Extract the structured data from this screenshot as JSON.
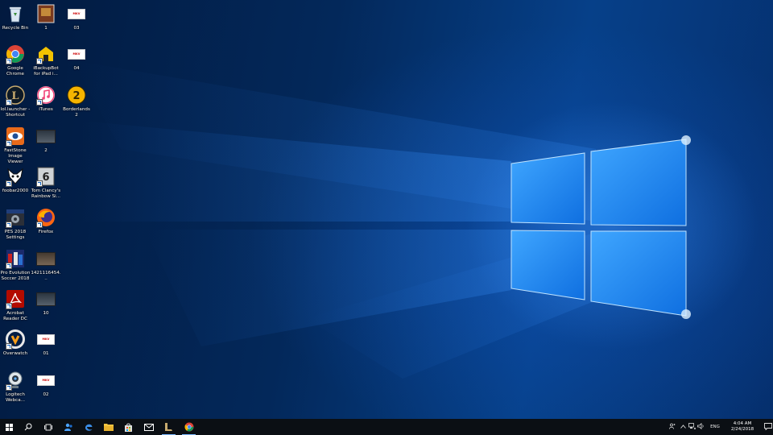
{
  "desktop": {
    "icons": [
      {
        "name": "recycle-bin",
        "label": "Recycle Bin"
      },
      {
        "name": "file-1",
        "label": "1"
      },
      {
        "name": "video-03",
        "label": "03",
        "badge": "MKV"
      },
      {
        "name": "google-chrome",
        "label": "Google Chrome"
      },
      {
        "name": "ibackupbot",
        "label": "iBackupBot for iPad i..."
      },
      {
        "name": "video-04",
        "label": "04",
        "badge": "MKV"
      },
      {
        "name": "lollauncher",
        "label": "lol.launcher - Shortcut"
      },
      {
        "name": "itunes",
        "label": "iTunes"
      },
      {
        "name": "borderlands-2",
        "label": "Borderlands 2"
      },
      {
        "name": "faststone",
        "label": "FastStone Image Viewer"
      },
      {
        "name": "file-2",
        "label": "2"
      },
      {
        "name": "foobar2000",
        "label": "foobar2000"
      },
      {
        "name": "rainbow-six",
        "label": "Tom Clancy's Rainbow Si..."
      },
      {
        "name": "pes-settings",
        "label": "PES 2018 Settings"
      },
      {
        "name": "firefox",
        "label": "Firefox"
      },
      {
        "name": "pes-2018",
        "label": "Pro Evolution Soccer 2018"
      },
      {
        "name": "file-142111",
        "label": "1421116454..."
      },
      {
        "name": "acrobat",
        "label": "Acrobat Reader DC"
      },
      {
        "name": "file-10",
        "label": "10"
      },
      {
        "name": "overwatch",
        "label": "Overwatch"
      },
      {
        "name": "video-01",
        "label": "01",
        "badge": "MKV"
      },
      {
        "name": "logitech",
        "label": "Logitech Webca..."
      },
      {
        "name": "video-02",
        "label": "02",
        "badge": "MKV"
      }
    ]
  },
  "taskbar": {
    "start_icon": "windows-logo",
    "search_icon": "search",
    "taskview_icon": "task-view",
    "pinned": [
      "people",
      "edge",
      "file-explorer",
      "store",
      "mail",
      "league-of-legends",
      "chrome"
    ],
    "tray": {
      "language": "ENG",
      "time": "4:04 AM",
      "date": "2/24/2018"
    }
  },
  "colors": {
    "accent": "#1e88ff",
    "taskbar": "#0b0f14"
  }
}
